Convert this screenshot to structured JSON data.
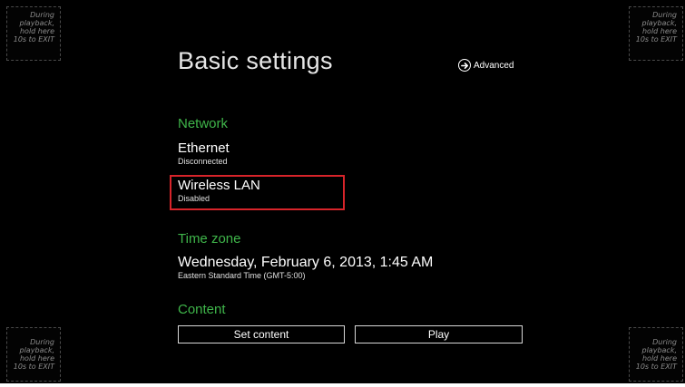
{
  "corner_hint": "During\nplayback,\nhold here\n10s to EXIT",
  "title": "Basic settings",
  "advanced": {
    "label": "Advanced",
    "icon": "arrow-right-circle-icon"
  },
  "network": {
    "heading": "Network",
    "ethernet": {
      "title": "Ethernet",
      "status": "Disconnected"
    },
    "wireless": {
      "title": "Wireless LAN",
      "status": "Disabled"
    }
  },
  "timezone": {
    "heading": "Time zone",
    "datetime": "Wednesday, February 6, 2013, 1:45 AM",
    "zone": "Eastern Standard Time (GMT-5:00)"
  },
  "content": {
    "heading": "Content",
    "set_content_label": "Set content",
    "play_label": "Play"
  },
  "colors": {
    "background": "#000000",
    "section_heading": "#3fb54a",
    "highlight": "#d7242a"
  }
}
